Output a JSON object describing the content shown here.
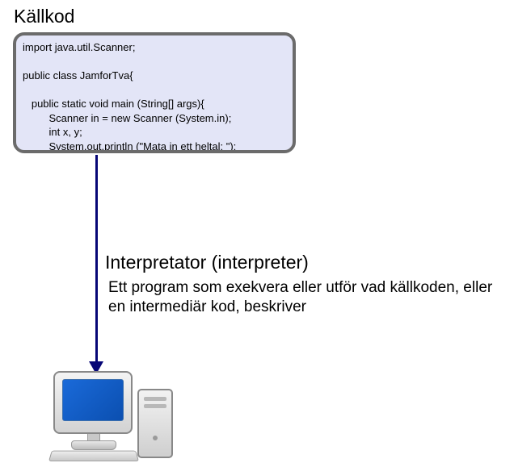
{
  "title": "Källkod",
  "source_code": "import java.util.Scanner;\n\npublic class JamforTva{\n\n   public static void main (String[] args){\n         Scanner in = new Scanner (System.in);\n         int x, y;\n         System.out.println (\"Mata in ett heltal: \");\n         ...",
  "interpreter": {
    "heading": "Interpretator (interpreter)",
    "description": "Ett program som exekvera eller utför vad källkoden, eller en intermediär kod,  beskriver"
  }
}
